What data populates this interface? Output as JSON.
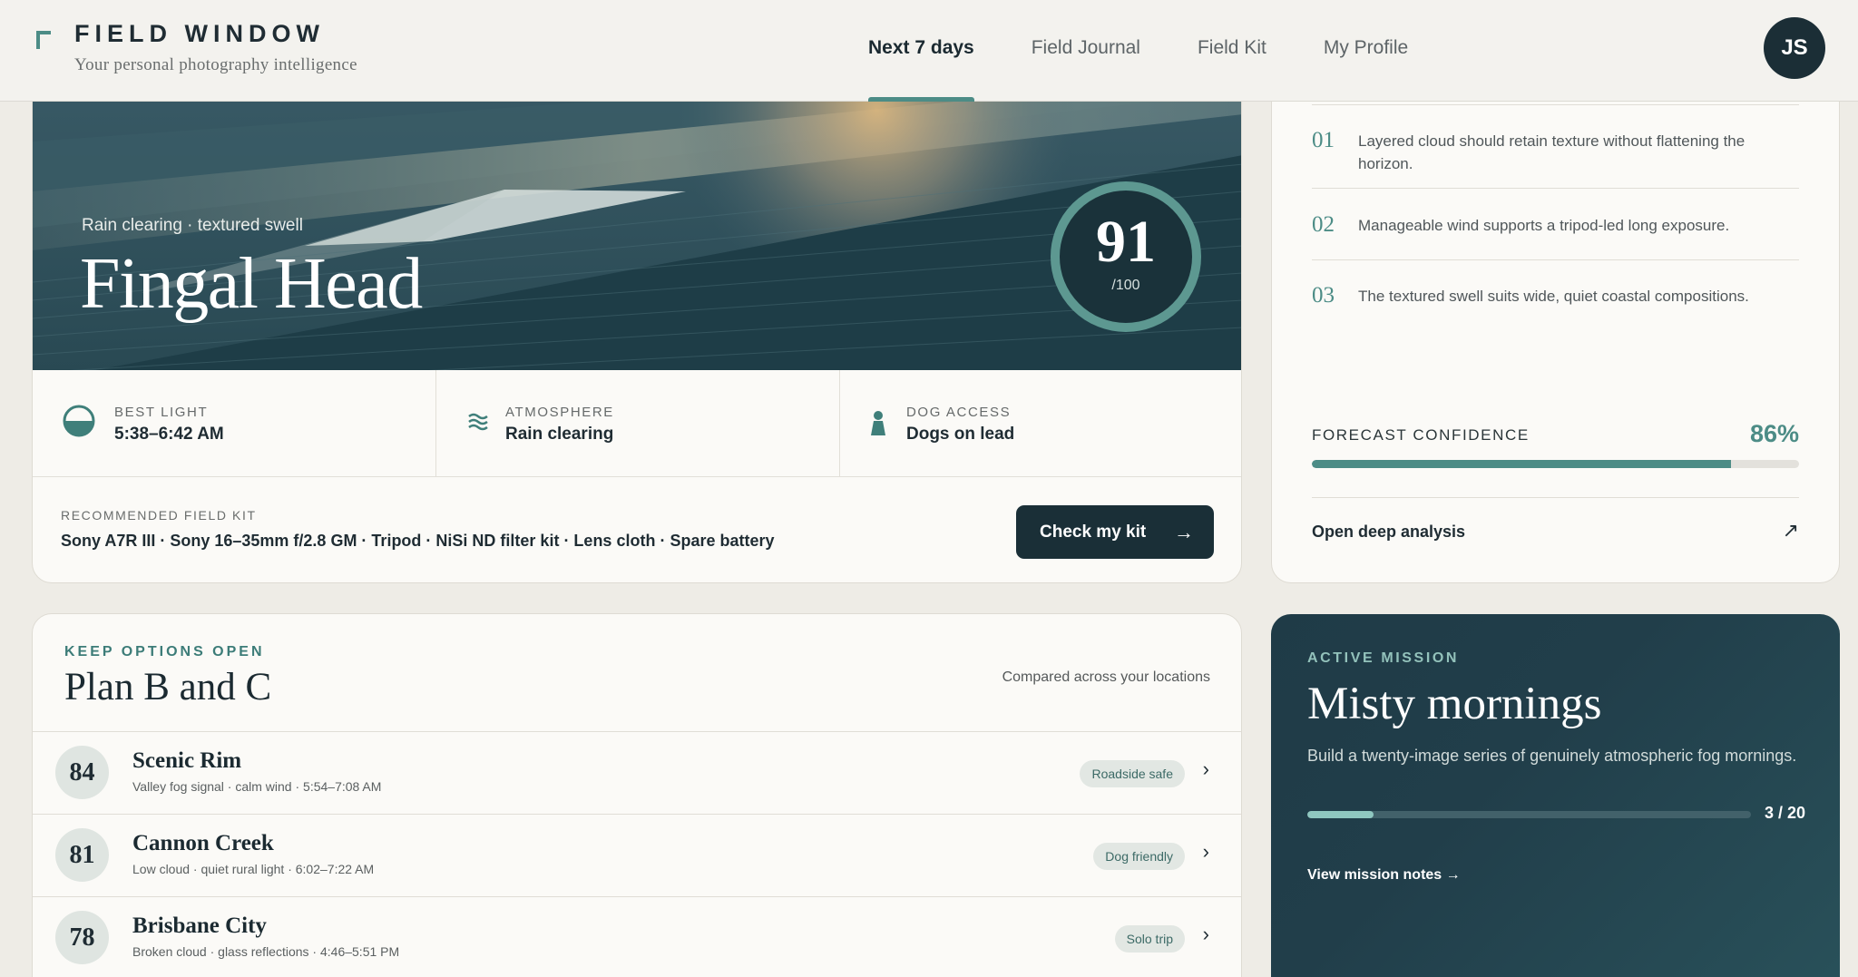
{
  "header": {
    "brand_title": "FIELD WINDOW",
    "brand_subtitle": "Your personal photography intelligence",
    "nav": [
      {
        "label": "Next 7 days",
        "active": true
      },
      {
        "label": "Field Journal",
        "active": false
      },
      {
        "label": "Field Kit",
        "active": false
      },
      {
        "label": "My Profile",
        "active": false
      }
    ],
    "avatar_initials": "JS"
  },
  "hero": {
    "subtitle": "Rain clearing · textured swell",
    "title": "Fingal Head",
    "score": "91",
    "score_max": "/100",
    "stats": [
      {
        "icon": "half-sun-icon",
        "label": "BEST LIGHT",
        "value": "5:38–6:42 AM"
      },
      {
        "icon": "waves-icon",
        "label": "ATMOSPHERE",
        "value": "Rain clearing"
      },
      {
        "icon": "dog-icon",
        "label": "DOG ACCESS",
        "value": "Dogs on lead"
      }
    ],
    "kit_label": "RECOMMENDED FIELD KIT",
    "kit_items": "Sony A7R III · Sony 16–35mm f/2.8 GM · Tripod · NiSi ND filter kit · Lens cloth · Spare battery",
    "kit_button": "Check my kit",
    "kit_button_arrow": "→"
  },
  "analysis": {
    "reasons": [
      {
        "num": "01",
        "text": "Layered cloud should retain texture without flattening the horizon."
      },
      {
        "num": "02",
        "text": "Manageable wind supports a tripod-led long exposure."
      },
      {
        "num": "03",
        "text": "The textured swell suits wide, quiet coastal compositions."
      }
    ],
    "confidence_label": "FORECAST CONFIDENCE",
    "confidence_value": "86%",
    "confidence_fraction": 0.86,
    "deep_link": "Open deep analysis",
    "deep_arrow": "↗"
  },
  "plans": {
    "kicker": "KEEP OPTIONS OPEN",
    "title": "Plan B and C",
    "note": "Compared across your locations",
    "rows": [
      {
        "score": "84",
        "name": "Scenic Rim",
        "detail": "Valley fog signal · calm wind · 5:54–7:08 AM",
        "badge": "Roadside safe"
      },
      {
        "score": "81",
        "name": "Cannon Creek",
        "detail": "Low cloud · quiet rural light · 6:02–7:22 AM",
        "badge": "Dog friendly"
      },
      {
        "score": "78",
        "name": "Brisbane City",
        "detail": "Broken cloud · glass reflections · 4:46–5:51 PM",
        "badge": "Solo trip"
      }
    ],
    "chevron": "›"
  },
  "mission": {
    "kicker": "ACTIVE MISSION",
    "title": "Misty mornings",
    "description": "Build a twenty-image series of genuinely atmospheric fog mornings.",
    "progress_count": "3 / 20",
    "progress_fraction": 0.15,
    "link": "View mission notes →"
  },
  "colors": {
    "accent": "#4c8c86",
    "dark": "#1a2f37",
    "background": "#eeece6"
  }
}
